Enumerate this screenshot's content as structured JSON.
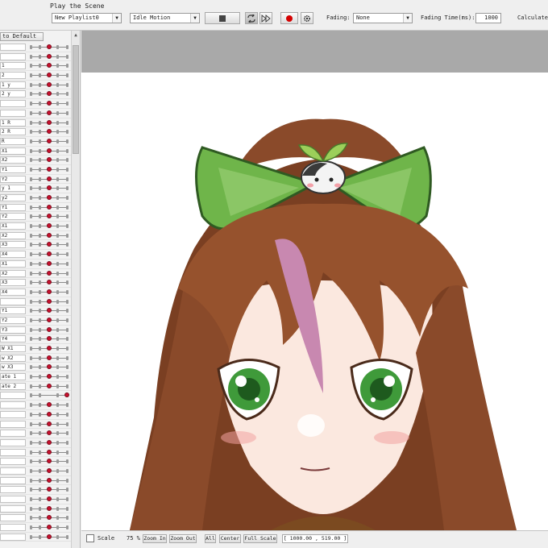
{
  "toolbar": {
    "play_title": "Play the Scene",
    "playlist_value": "New Playlist0",
    "motion_value": "Idle Motion",
    "stop_icon": "stop-icon",
    "loop_icon": "loop-icon",
    "fast_forward_icon": "fast-forward-icon",
    "record_icon": "record-icon",
    "settings_icon": "gear-icon",
    "fading_label": "Fading:",
    "fading_value": "None",
    "fading_time_label": "Fading Time(ms):",
    "fading_time_value": "1000",
    "calculate_label": "Calculate"
  },
  "left_panel": {
    "reset_label": "to Default",
    "params": [
      {
        "name": "",
        "knob": 0.5
      },
      {
        "name": "",
        "knob": 0.5
      },
      {
        "name": "1",
        "knob": 0.5
      },
      {
        "name": "2",
        "knob": 0.5
      },
      {
        "name": "1 y",
        "knob": 0.5
      },
      {
        "name": "2 y",
        "knob": 0.5
      },
      {
        "name": "",
        "knob": 0.5
      },
      {
        "name": "",
        "knob": 0.5
      },
      {
        "name": "1 R",
        "knob": 0.5
      },
      {
        "name": "2 R",
        "knob": 0.5
      },
      {
        "name": "R",
        "knob": 0.5
      },
      {
        "name": "X1",
        "knob": 0.5
      },
      {
        "name": "X2",
        "knob": 0.5
      },
      {
        "name": "Y1",
        "knob": 0.5
      },
      {
        "name": "Y2",
        "knob": 0.5
      },
      {
        "name": "y 1",
        "knob": 0.5
      },
      {
        "name": "y2",
        "knob": 0.5
      },
      {
        "name": "Y1",
        "knob": 0.5
      },
      {
        "name": "Y2",
        "knob": 0.5
      },
      {
        "name": "X1",
        "knob": 0.5
      },
      {
        "name": "X2",
        "knob": 0.5
      },
      {
        "name": "X3",
        "knob": 0.5
      },
      {
        "name": "X4",
        "knob": 0.5
      },
      {
        "name": "X1",
        "knob": 0.5
      },
      {
        "name": "X2",
        "knob": 0.5
      },
      {
        "name": "X3",
        "knob": 0.5
      },
      {
        "name": "X4",
        "knob": 0.5
      },
      {
        "name": "",
        "knob": 0.5
      },
      {
        "name": "Y1",
        "knob": 0.5
      },
      {
        "name": "Y2",
        "knob": 0.5
      },
      {
        "name": "Y3",
        "knob": 0.5
      },
      {
        "name": "Y4",
        "knob": 0.5
      },
      {
        "name": "W X1",
        "knob": 0.5
      },
      {
        "name": "w X2",
        "knob": 0.5
      },
      {
        "name": "w X3",
        "knob": 0.5
      },
      {
        "name": "ate 1",
        "knob": 0.5
      },
      {
        "name": "ate 2",
        "knob": 0.5
      },
      {
        "name": "",
        "knob": 1.0
      },
      {
        "name": "",
        "knob": 0.5
      },
      {
        "name": "",
        "knob": 0.5
      },
      {
        "name": "",
        "knob": 0.5
      },
      {
        "name": "",
        "knob": 0.5
      },
      {
        "name": "",
        "knob": 0.5
      },
      {
        "name": "",
        "knob": 0.5
      },
      {
        "name": "",
        "knob": 0.5
      },
      {
        "name": "",
        "knob": 0.5
      },
      {
        "name": "",
        "knob": 0.5
      },
      {
        "name": "",
        "knob": 0.5
      },
      {
        "name": "",
        "knob": 0.5
      },
      {
        "name": "",
        "knob": 0.5
      },
      {
        "name": "",
        "knob": 0.5
      },
      {
        "name": "",
        "knob": 0.5
      },
      {
        "name": "",
        "knob": 0.5
      }
    ]
  },
  "bottom_bar": {
    "scale_label": "Scale",
    "zoom_value": "75 %",
    "zoom_in_label": "Zoom In",
    "zoom_out_label": "Zoom Out",
    "all_label": "All",
    "center_label": "Center",
    "full_scale_label": "Full Scale",
    "coords_readout": "[ 1000.00 , 519.00 ]"
  },
  "colors": {
    "knob": "#c8102e",
    "canvas_bg": "#a9a9a9",
    "hair": "#8a4a2a",
    "ribbon": "#6fb54a",
    "eye": "#3f9a3a"
  }
}
